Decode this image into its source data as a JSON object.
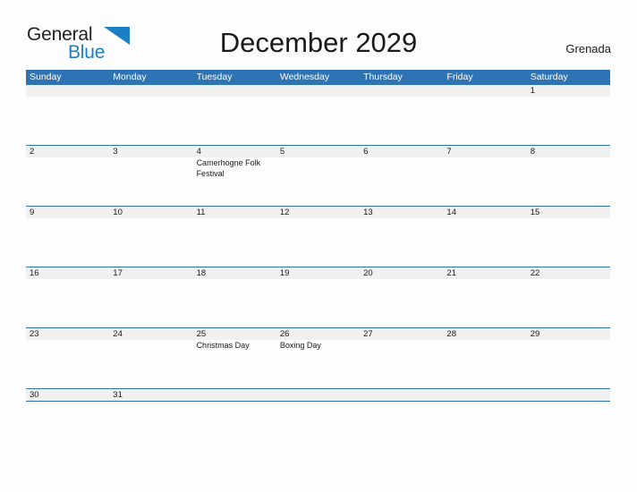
{
  "brand": {
    "name_part1": "General",
    "name_part2": "Blue",
    "flag_icon": "blue-flag-triangle",
    "color_dark": "#231f20",
    "color_blue": "#1b7fc4"
  },
  "header": {
    "title": "December 2029",
    "country": "Grenada"
  },
  "theme": {
    "header_blue": "#2e74b5",
    "date_band_gray": "#f0f0f0",
    "page_background": "#fdfdfd",
    "text_color": "#1a1a1a"
  },
  "calendar": {
    "weekday_headers": [
      "Sunday",
      "Monday",
      "Tuesday",
      "Wednesday",
      "Thursday",
      "Friday",
      "Saturday"
    ],
    "weeks": [
      {
        "days": [
          {
            "date": "",
            "events": []
          },
          {
            "date": "",
            "events": []
          },
          {
            "date": "",
            "events": []
          },
          {
            "date": "",
            "events": []
          },
          {
            "date": "",
            "events": []
          },
          {
            "date": "",
            "events": []
          },
          {
            "date": "1",
            "events": []
          }
        ]
      },
      {
        "days": [
          {
            "date": "2",
            "events": []
          },
          {
            "date": "3",
            "events": []
          },
          {
            "date": "4",
            "events": [
              "Camerhogne Folk Festival"
            ]
          },
          {
            "date": "5",
            "events": []
          },
          {
            "date": "6",
            "events": []
          },
          {
            "date": "7",
            "events": []
          },
          {
            "date": "8",
            "events": []
          }
        ]
      },
      {
        "days": [
          {
            "date": "9",
            "events": []
          },
          {
            "date": "10",
            "events": []
          },
          {
            "date": "11",
            "events": []
          },
          {
            "date": "12",
            "events": []
          },
          {
            "date": "13",
            "events": []
          },
          {
            "date": "14",
            "events": []
          },
          {
            "date": "15",
            "events": []
          }
        ]
      },
      {
        "days": [
          {
            "date": "16",
            "events": []
          },
          {
            "date": "17",
            "events": []
          },
          {
            "date": "18",
            "events": []
          },
          {
            "date": "19",
            "events": []
          },
          {
            "date": "20",
            "events": []
          },
          {
            "date": "21",
            "events": []
          },
          {
            "date": "22",
            "events": []
          }
        ]
      },
      {
        "days": [
          {
            "date": "23",
            "events": []
          },
          {
            "date": "24",
            "events": []
          },
          {
            "date": "25",
            "events": [
              "Christmas Day"
            ]
          },
          {
            "date": "26",
            "events": [
              "Boxing Day"
            ]
          },
          {
            "date": "27",
            "events": []
          },
          {
            "date": "28",
            "events": []
          },
          {
            "date": "29",
            "events": []
          }
        ]
      },
      {
        "short": true,
        "days": [
          {
            "date": "30",
            "events": []
          },
          {
            "date": "31",
            "events": []
          },
          {
            "date": "",
            "events": []
          },
          {
            "date": "",
            "events": []
          },
          {
            "date": "",
            "events": []
          },
          {
            "date": "",
            "events": []
          },
          {
            "date": "",
            "events": []
          }
        ]
      }
    ]
  }
}
